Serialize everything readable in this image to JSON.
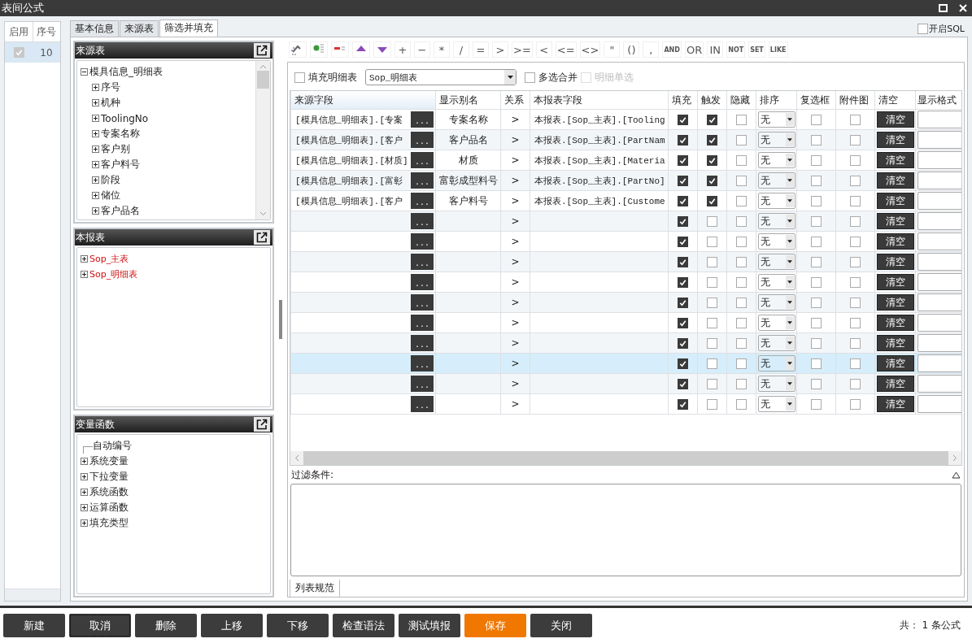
{
  "window": {
    "title": "表间公式"
  },
  "formula_list": {
    "columns": [
      "启用",
      "序号"
    ],
    "rows": [
      {
        "enabled": true,
        "number": "10",
        "selected": true
      }
    ]
  },
  "tabs": [
    {
      "label": "基本信息",
      "selected": false
    },
    {
      "label": "来源表",
      "selected": false
    },
    {
      "label": "筛选并填充",
      "selected": true
    }
  ],
  "sql_toggle": {
    "label": "开启SQL",
    "checked": false
  },
  "source_panel": {
    "title": "来源表",
    "tree": [
      {
        "label": "模具信息_明细表",
        "expanded": true,
        "children": [
          {
            "label": "序号",
            "expanded": false
          },
          {
            "label": "机种",
            "expanded": false
          },
          {
            "label": "ToolingNo",
            "expanded": false
          },
          {
            "label": "专案名称",
            "expanded": false
          },
          {
            "label": "客户别",
            "expanded": false
          },
          {
            "label": "客户料号",
            "expanded": false
          },
          {
            "label": "阶段",
            "expanded": false
          },
          {
            "label": "储位",
            "expanded": false
          },
          {
            "label": "客户品名",
            "expanded": false
          }
        ]
      }
    ]
  },
  "report_panel": {
    "title": "本报表",
    "tree": [
      {
        "label": "Sop_主表",
        "expanded": false
      },
      {
        "label": "Sop_明细表",
        "expanded": false
      }
    ]
  },
  "function_panel": {
    "title": "变量函数",
    "tree": [
      {
        "label": "自动编号"
      },
      {
        "label": "系统变量",
        "expanded": false
      },
      {
        "label": "下拉变量",
        "expanded": false
      },
      {
        "label": "系统函数",
        "expanded": false
      },
      {
        "label": "运算函数",
        "expanded": false
      },
      {
        "label": "填充类型",
        "expanded": false
      }
    ]
  },
  "operators": [
    "+",
    "−",
    "*",
    "/",
    "=",
    ">",
    ">=",
    "<",
    "<=",
    "<>",
    "\"",
    "()",
    ",",
    "AND",
    "OR",
    "IN",
    "NOT",
    "SET",
    "LIKE"
  ],
  "options": {
    "fill_detail": {
      "label": "填充明细表",
      "checked": false
    },
    "detail_table": "Sop_明细表",
    "multi_merge": {
      "label": "多选合并",
      "checked": false
    },
    "detail_single": {
      "label": "明细单选",
      "checked": false,
      "disabled": true
    }
  },
  "grid": {
    "columns": [
      "来源字段",
      "显示别名",
      "关系",
      "本报表字段",
      "填充",
      "触发",
      "隐藏",
      "排序",
      "复选框",
      "附件图",
      "清空",
      "显示格式"
    ],
    "rows": [
      {
        "source": "[模具信息_明细表].[专案",
        "browse": "...",
        "alias": "专案名称",
        "relation": ">",
        "target": "本报表.[Sop_主表].[Tooling",
        "fill": true,
        "trigger": true,
        "hidden": false,
        "sort": "无",
        "checkbox": false,
        "attachment": false,
        "clear": "清空",
        "selected": false
      },
      {
        "source": "[模具信息_明细表].[客户",
        "browse": "...",
        "alias": "客户品名",
        "relation": ">",
        "target": "本报表.[Sop_主表].[PartNam",
        "fill": true,
        "trigger": true,
        "hidden": false,
        "sort": "无",
        "checkbox": false,
        "attachment": false,
        "clear": "清空",
        "selected": false
      },
      {
        "source": "[模具信息_明细表].[材质]",
        "browse": "...",
        "alias": "材质",
        "relation": ">",
        "target": "本报表.[Sop_主表].[Materia",
        "fill": true,
        "trigger": true,
        "hidden": false,
        "sort": "无",
        "checkbox": false,
        "attachment": false,
        "clear": "清空",
        "selected": false
      },
      {
        "source": "[模具信息_明细表].[富彰",
        "browse": "...",
        "alias": "富彰成型料号",
        "relation": ">",
        "target": "本报表.[Sop_主表].[PartNo]",
        "fill": true,
        "trigger": true,
        "hidden": false,
        "sort": "无",
        "checkbox": false,
        "attachment": false,
        "clear": "清空",
        "selected": false
      },
      {
        "source": "[模具信息_明细表].[客户",
        "browse": "...",
        "alias": "客户料号",
        "relation": ">",
        "target": "本报表.[Sop_主表].[Custome",
        "fill": true,
        "trigger": true,
        "hidden": false,
        "sort": "无",
        "checkbox": false,
        "attachment": false,
        "clear": "清空",
        "selected": false
      },
      {
        "browse": "...",
        "relation": ">",
        "fill": true,
        "trigger": false,
        "hidden": false,
        "sort": "无",
        "checkbox": false,
        "attachment": false,
        "clear": "清空",
        "selected": false
      },
      {
        "browse": "...",
        "relation": ">",
        "fill": true,
        "trigger": false,
        "hidden": false,
        "sort": "无",
        "checkbox": false,
        "attachment": false,
        "clear": "清空",
        "selected": false
      },
      {
        "browse": "...",
        "relation": ">",
        "fill": true,
        "trigger": false,
        "hidden": false,
        "sort": "无",
        "checkbox": false,
        "attachment": false,
        "clear": "清空",
        "selected": false
      },
      {
        "browse": "...",
        "relation": ">",
        "fill": true,
        "trigger": false,
        "hidden": false,
        "sort": "无",
        "checkbox": false,
        "attachment": false,
        "clear": "清空",
        "selected": false
      },
      {
        "browse": "...",
        "relation": ">",
        "fill": true,
        "trigger": false,
        "hidden": false,
        "sort": "无",
        "checkbox": false,
        "attachment": false,
        "clear": "清空",
        "selected": false
      },
      {
        "browse": "...",
        "relation": ">",
        "fill": true,
        "trigger": false,
        "hidden": false,
        "sort": "无",
        "checkbox": false,
        "attachment": false,
        "clear": "清空",
        "selected": false
      },
      {
        "browse": "...",
        "relation": ">",
        "fill": true,
        "trigger": false,
        "hidden": false,
        "sort": "无",
        "checkbox": false,
        "attachment": false,
        "clear": "清空",
        "selected": false
      },
      {
        "browse": "...",
        "relation": ">",
        "fill": true,
        "trigger": false,
        "hidden": false,
        "sort": "无",
        "checkbox": false,
        "attachment": false,
        "clear": "清空",
        "selected": true
      },
      {
        "browse": "...",
        "relation": ">",
        "fill": true,
        "trigger": false,
        "hidden": false,
        "sort": "无",
        "checkbox": false,
        "attachment": false,
        "clear": "清空",
        "selected": false
      },
      {
        "browse": "...",
        "relation": ">",
        "fill": true,
        "trigger": false,
        "hidden": false,
        "sort": "无",
        "checkbox": false,
        "attachment": false,
        "clear": "清空",
        "selected": false
      }
    ]
  },
  "filter": {
    "label": "过滤条件:"
  },
  "bottom_tab": {
    "label": "列表规范"
  },
  "buttons": [
    {
      "label": "新建",
      "kind": "normal",
      "focused": false
    },
    {
      "label": "取消",
      "kind": "normal",
      "focused": true
    },
    {
      "label": "删除",
      "kind": "normal",
      "focused": false
    },
    {
      "label": "上移",
      "kind": "normal",
      "focused": false
    },
    {
      "label": "下移",
      "kind": "normal",
      "focused": false
    },
    {
      "label": "检查语法",
      "kind": "normal",
      "focused": false
    },
    {
      "label": "测试填报",
      "kind": "normal",
      "focused": false
    },
    {
      "label": "保存",
      "kind": "primary",
      "focused": false
    },
    {
      "label": "关闭",
      "kind": "normal",
      "focused": false
    }
  ],
  "status": "共： 1 条公式"
}
